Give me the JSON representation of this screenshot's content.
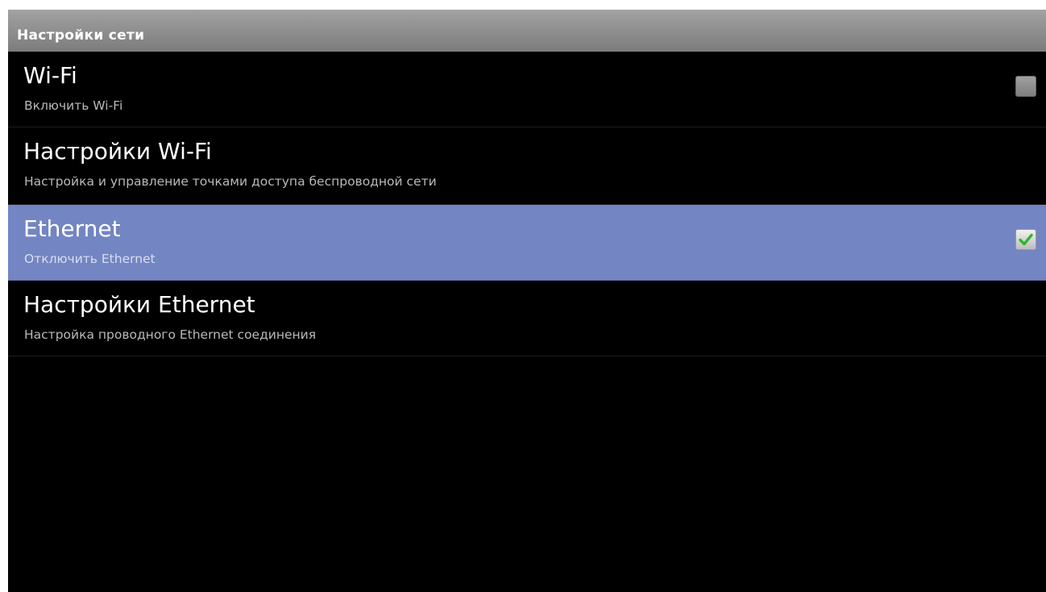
{
  "header": {
    "title": "Настройки сети"
  },
  "colors": {
    "selected_row": "#7385c2",
    "check_mark": "#2eb82e",
    "header_bg": "#8e8e8e"
  },
  "items": [
    {
      "title": "Wi-Fi",
      "summary": "Включить Wi-Fi",
      "checkbox": {
        "checked": false,
        "enabled": false
      }
    },
    {
      "title": "Настройки Wi-Fi",
      "summary": "Настройка и управление точками доступа беспроводной сети"
    },
    {
      "title": "Ethernet",
      "summary": "Отключить Ethernet",
      "selected": true,
      "checkbox": {
        "checked": true,
        "enabled": true,
        "icon": "check-icon"
      }
    },
    {
      "title": "Настройки Ethernet",
      "summary": "Настройка проводного Ethernet соединения"
    }
  ]
}
